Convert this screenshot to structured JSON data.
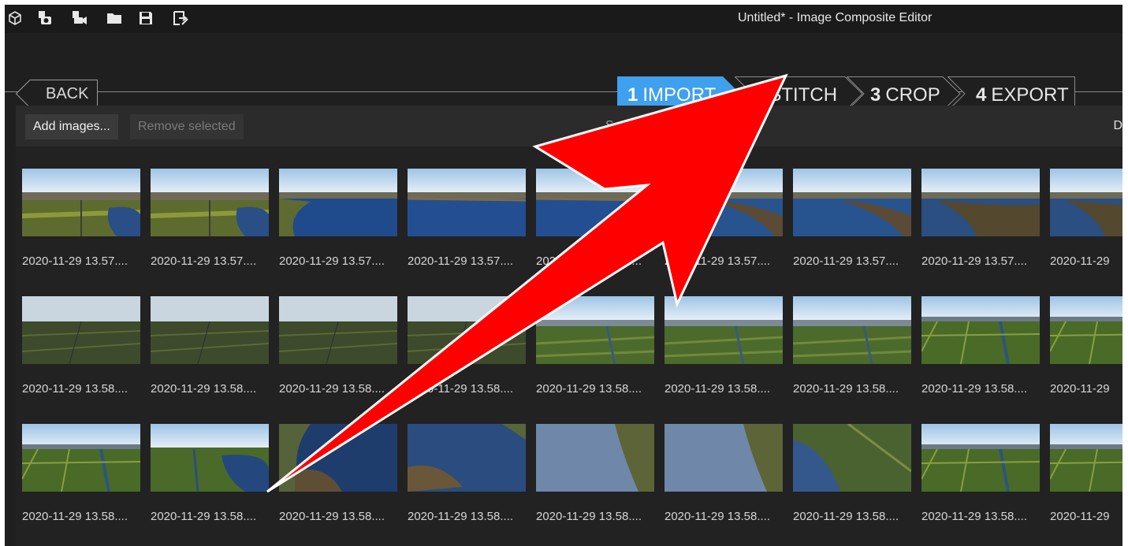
{
  "window": {
    "title": "Untitled* - Image Composite Editor"
  },
  "toolbar_icons": [
    "cube-icon",
    "new-panorama-from-images-icon",
    "new-panorama-from-video-icon",
    "open-folder-icon",
    "save-icon",
    "export-icon"
  ],
  "nav": {
    "back_label": "BACK",
    "steps": [
      {
        "number": "1",
        "label": "IMPORT",
        "active": true
      },
      {
        "number": "2",
        "label": "STITCH",
        "active": false
      },
      {
        "number": "3",
        "label": "CROP",
        "active": false
      },
      {
        "number": "4",
        "label": "EXPORT",
        "active": false
      }
    ],
    "active_color": "#3fa0ee"
  },
  "actions": {
    "add_images": "Add images...",
    "remove_selected": "Remove selected",
    "partial_s": "S",
    "partial_right": "D"
  },
  "images": {
    "rows": [
      {
        "labels": [
          "2020-11-29 13.57....",
          "2020-11-29 13.57....",
          "2020-11-29 13.57....",
          "2020-11-29 13.57....",
          "2020-11-29 13.57....",
          "2020-11-29 13.57....",
          "2020-11-29 13.57....",
          "2020-11-29 13.57....",
          "2020-11-29"
        ],
        "kinds": [
          "field-lake-small",
          "field-lake-small",
          "lake-left",
          "lake-wide",
          "lake-wide",
          "lake-right",
          "lake-right",
          "lake-trees",
          "lake-trees"
        ]
      },
      {
        "labels": [
          "2020-11-29 13.58....",
          "2020-11-29 13.58....",
          "2020-11-29 13.58....",
          "2020-11-29 13.58....",
          "2020-11-29 13.58....",
          "2020-11-29 13.58....",
          "2020-11-29 13.58....",
          "2020-11-29 13.58....",
          "2020-11-29"
        ],
        "kinds": [
          "fields-haze",
          "fields-haze",
          "fields-haze",
          "fields-haze",
          "fields-town",
          "fields-town",
          "fields-town",
          "fields-canal",
          "fields-canal"
        ]
      },
      {
        "labels": [
          "2020-11-29 13.58....",
          "2020-11-29 13.58....",
          "2020-11-29 13.58....",
          "2020-11-29 13.58....",
          "2020-11-29 13.58....",
          "2020-11-29 13.58....",
          "2020-11-29 13.58....",
          "2020-11-29 13.58....",
          "2020-11-29"
        ],
        "kinds": [
          "fields-canal",
          "canal-lake",
          "lake-shore",
          "lake-island",
          "lake-bright",
          "lake-bright",
          "shore-fields",
          "fields-canal",
          "fields-canal"
        ]
      }
    ]
  },
  "annotation": {
    "color": "#ff0000",
    "points_to": "2 STITCH"
  }
}
